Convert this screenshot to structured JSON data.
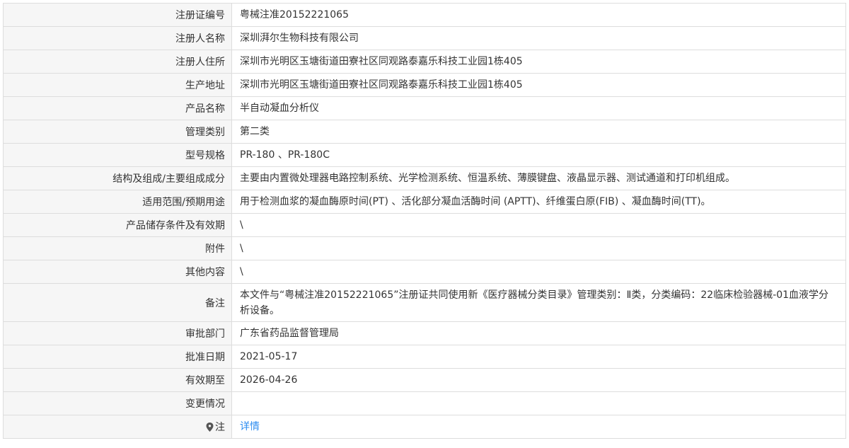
{
  "rows": [
    {
      "label": "注册证编号",
      "value": "粤械注准20152221065"
    },
    {
      "label": "注册人名称",
      "value": "深圳湃尔生物科技有限公司"
    },
    {
      "label": "注册人住所",
      "value": "深圳市光明区玉塘街道田寮社区同观路泰嘉乐科技工业园1栋405"
    },
    {
      "label": "生产地址",
      "value": "深圳市光明区玉塘街道田寮社区同观路泰嘉乐科技工业园1栋405"
    },
    {
      "label": "产品名称",
      "value": "半自动凝血分析仪"
    },
    {
      "label": "管理类别",
      "value": "第二类"
    },
    {
      "label": "型号规格",
      "value": "PR-180 、PR-180C"
    },
    {
      "label": "结构及组成/主要组成成分",
      "value": "主要由内置微处理器电路控制系统、光学检测系统、恒温系统、薄膜键盘、液晶显示器、测试通道和打印机组成。"
    },
    {
      "label": "适用范围/预期用途",
      "value": "用于检测血浆的凝血酶原时间(PT) 、活化部分凝血活酶时间 (APTT)、纤维蛋白原(FIB) 、凝血酶时间(TT)。"
    },
    {
      "label": "产品储存条件及有效期",
      "value": "\\"
    },
    {
      "label": "附件",
      "value": "\\"
    },
    {
      "label": "其他内容",
      "value": "\\"
    },
    {
      "label": "备注",
      "value": "本文件与“粤械注准20152221065”注册证共同使用新《医疗器械分类目录》管理类别：Ⅱ类，分类编码：22临床检验器械-01血液学分析设备。"
    },
    {
      "label": "审批部门",
      "value": "广东省药品监督管理局"
    },
    {
      "label": "批准日期",
      "value": "2021-05-17"
    },
    {
      "label": "有效期至",
      "value": "2026-04-26"
    },
    {
      "label": "变更情况",
      "value": ""
    },
    {
      "label": "注",
      "value": "详情"
    }
  ],
  "icons": {
    "note_marker": "location-pin-icon"
  },
  "colors": {
    "link": "#2d8cf0",
    "label_bg": "#f6f6f6",
    "border": "#dddddd"
  }
}
